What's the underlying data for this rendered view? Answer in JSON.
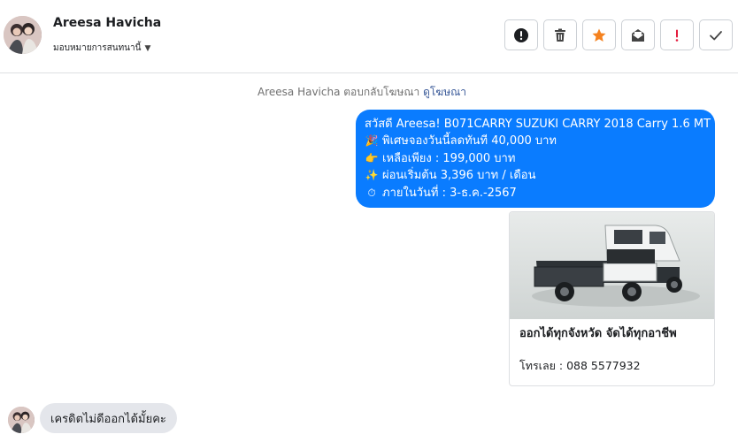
{
  "contact": {
    "name": "Areesa Havicha",
    "assign_label": "มอบหมายการสนทนานี้",
    "avatar_icon": "profile-photo"
  },
  "toolbar": {
    "buttons": [
      {
        "icon": "alert-circle-icon",
        "color": "#1c1e21"
      },
      {
        "icon": "trash-icon",
        "color": "#444444"
      },
      {
        "icon": "star-icon",
        "color": "#f5821f"
      },
      {
        "icon": "mark-unread-icon",
        "color": "#444444"
      },
      {
        "icon": "exclamation-icon",
        "color": "#e41e3f"
      },
      {
        "icon": "check-icon",
        "color": "#444444"
      }
    ]
  },
  "thread": {
    "meta_text": "Areesa Havicha ตอบกลับโฆษณา",
    "meta_link": "ดูโฆษณา",
    "outgoing": {
      "color": "#0a7cff",
      "lines": [
        {
          "emoji": "",
          "text": "สวัสดี Areesa! B071CARRY  SUZUKI CARRY 2018 Carry 1.6 MT"
        },
        {
          "emoji": "🎉",
          "text": "พิเศษจองวันนี้ลดทันที 40,000 บาท"
        },
        {
          "emoji": "👉",
          "text": "เหลือเพียง : 199,000 บาท"
        },
        {
          "emoji": "✨",
          "text": "ผ่อนเริ่มต้น 3,396 บาท / เดือน"
        },
        {
          "emoji": "⏱",
          "text": "ภายในวันที่ : 3-ธ.ค.-2567"
        }
      ]
    },
    "ad_card": {
      "title": "ออกได้ทุกจังหวัด จัดได้ทุกอาชีพ",
      "subtitle": "โทรเลย : 088 5577932"
    },
    "incoming": {
      "text": "เครดิตไม่ดีออกได้มั้ยคะ"
    }
  }
}
